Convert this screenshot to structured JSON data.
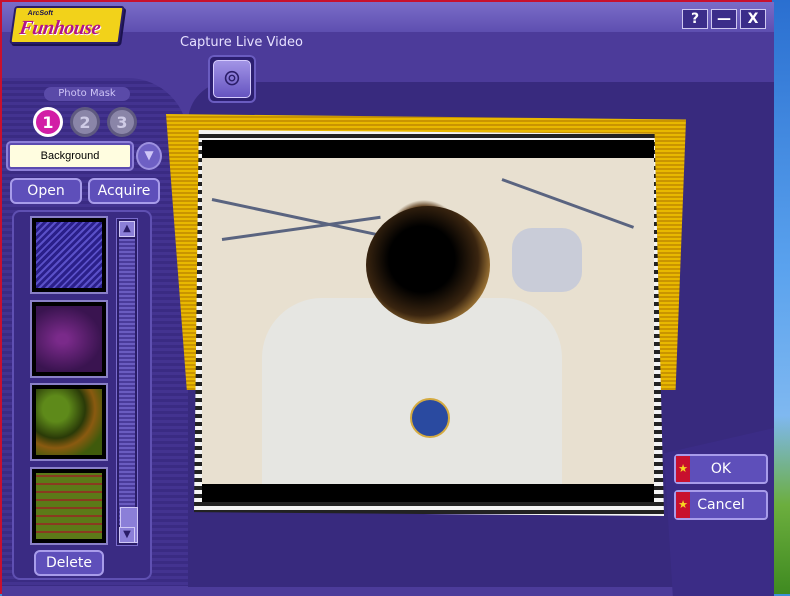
{
  "app": {
    "logo_small": "ArcSoft",
    "logo_text": "Funhouse"
  },
  "window_buttons": {
    "help": "?",
    "minimize": "—",
    "close": "X"
  },
  "capture": {
    "label": "Capture Live Video"
  },
  "photo_mask": {
    "label": "Photo Mask",
    "steps": [
      "1",
      "2",
      "3"
    ],
    "active_step": 1
  },
  "background_select": {
    "value": "Background"
  },
  "panel_buttons": {
    "open": "Open",
    "acquire": "Acquire",
    "delete": "Delete"
  },
  "thumbnails": [
    {
      "name": "purple-pattern",
      "color": "#3a2fa0"
    },
    {
      "name": "violet-swirl",
      "color": "#5a2270"
    },
    {
      "name": "green-orange-pattern",
      "color": "#6f7a10"
    },
    {
      "name": "text-pattern",
      "color": "#5c6a18"
    }
  ],
  "dialog_buttons": {
    "ok": "OK",
    "cancel": "Cancel"
  },
  "colors": {
    "accent_magenta": "#d21ea6",
    "frame_yellow": "#e8b800",
    "panel_purple": "#4c3b9a"
  }
}
